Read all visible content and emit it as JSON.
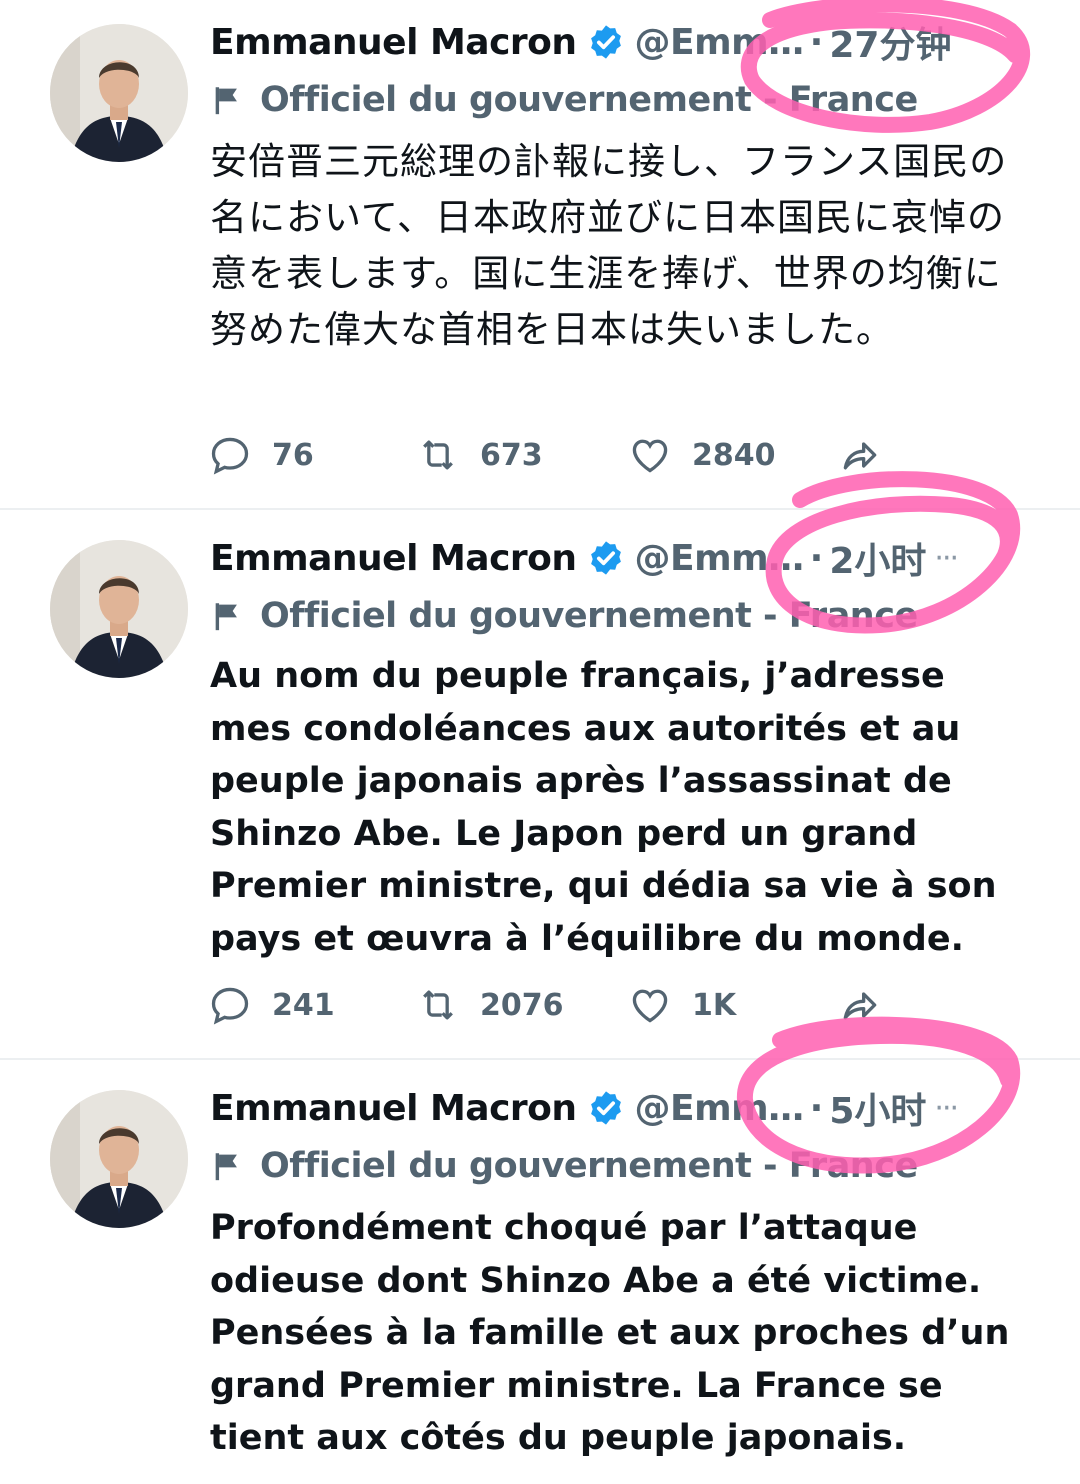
{
  "tweets": [
    {
      "author_name": "Emmanuel Macron",
      "handle": "@Emm…",
      "dot": "·",
      "time": "27分钟",
      "label": "Officiel du gouvernement - France",
      "text": "安倍晋三元総理の訃報に接し、フランス国民の名において、日本政府並びに日本国民に哀悼の意を表します。国に生涯を捧げ、世界の均衡に努めた偉大な首相を日本は失いました。",
      "replies": "76",
      "retweets": "673",
      "likes": "2840"
    },
    {
      "author_name": "Emmanuel Macron",
      "handle": "@Emm…",
      "dot": "·",
      "time": "2小时",
      "label": "Officiel du gouvernement - France",
      "text": "Au nom du peuple français, j’adresse mes condoléances aux autorités et au peuple japonais après l’assassinat de Shinzo Abe. Le Japon perd un grand Premier ministre, qui dédia sa vie à son pays et œuvra à l’équilibre du monde.",
      "replies": "241",
      "retweets": "2076",
      "likes": "1K"
    },
    {
      "author_name": "Emmanuel Macron",
      "handle": "@Emm…",
      "dot": "·",
      "time": "5小时",
      "label": "Officiel du gouvernement - France",
      "text": "Profondément choqué par l’attaque odieuse dont Shinzo Abe a été victime. Pensées à la famille et aux proches d’un grand Premier ministre. La France se tient aux côtés du peuple japonais."
    }
  ],
  "colors": {
    "verified": "#1d9bf0",
    "secondary_text": "#536471",
    "annotation": "#ff5fb0"
  },
  "icons": [
    "verified-badge-icon",
    "government-flag-icon",
    "reply-icon",
    "retweet-icon",
    "like-icon",
    "share-icon",
    "more-icon"
  ]
}
